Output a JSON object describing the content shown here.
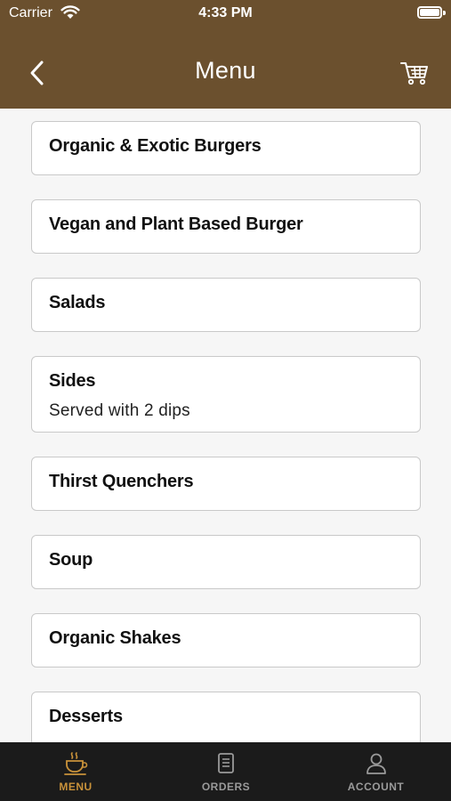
{
  "status_bar": {
    "carrier": "Carrier",
    "time": "4:33 PM"
  },
  "header": {
    "title": "Menu",
    "back_icon": "chevron-left-icon",
    "cart_icon": "cart-icon"
  },
  "menu": {
    "items": [
      {
        "title": "Organic & Exotic Burgers",
        "subtitle": ""
      },
      {
        "title": "Vegan and Plant Based Burger",
        "subtitle": ""
      },
      {
        "title": "Salads",
        "subtitle": ""
      },
      {
        "title": "Sides",
        "subtitle": "Served with 2 dips"
      },
      {
        "title": "Thirst Quenchers",
        "subtitle": ""
      },
      {
        "title": "Soup",
        "subtitle": ""
      },
      {
        "title": "Organic Shakes",
        "subtitle": ""
      },
      {
        "title": "Desserts",
        "subtitle": ""
      }
    ]
  },
  "tabbar": {
    "tabs": [
      {
        "label": "MENU",
        "icon": "coffee-cup-icon",
        "active": true
      },
      {
        "label": "ORDERS",
        "icon": "receipt-icon",
        "active": false
      },
      {
        "label": "ACCOUNT",
        "icon": "person-icon",
        "active": false
      }
    ]
  },
  "colors": {
    "header_bg": "#6b502e",
    "tab_active": "#c9923a",
    "tab_inactive": "#9a9a9a",
    "tabbar_bg": "#1b1b1b"
  }
}
